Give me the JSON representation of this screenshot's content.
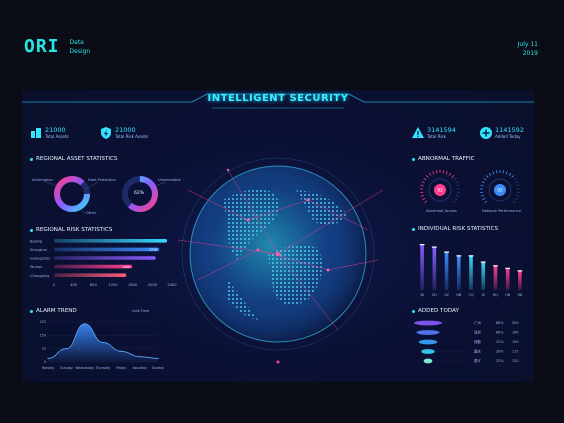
{
  "header": {
    "logo": "ORI",
    "brand_line1": "Data",
    "brand_line2": "Design",
    "date_line1": "July 11",
    "date_line2": "2019"
  },
  "title": "INTELLIGENT SECURITY",
  "stats_left": [
    {
      "value": "21000",
      "label": "Total Assets",
      "icon": "buildings-icon"
    },
    {
      "value": "21000",
      "label": "Total Risk Assets",
      "icon": "shield-bolt-icon"
    }
  ],
  "stats_right": [
    {
      "value": "3141594",
      "label": "Total Risk",
      "icon": "warning-icon"
    },
    {
      "value": "1141592",
      "label": "Added Today",
      "icon": "plus-circle-icon"
    }
  ],
  "sections": {
    "regional_asset": "REGIONAL ASSET STATISTICS",
    "regional_risk": "REGIONAL RISK STATISTICS",
    "alarm_trend": "ALARM TREND",
    "abnormal_traffic": "ABNORMAL TRAFFIC",
    "individual_risk": "INDIVIDUAL RISK STATISTICS",
    "added_today": "ADDED TODAY"
  },
  "donuts": {
    "left_labels": [
      "Information",
      "Data Protection",
      "Other"
    ],
    "right_center": "62%",
    "right_labels": [
      "Unreachable"
    ]
  },
  "regional_risk": {
    "categories": [
      "Beijing",
      "Shanghai",
      "Guangzhou",
      "Wuhan",
      "Chongqing"
    ],
    "values": [
      2300,
      2140,
      2070,
      1590,
      1470
    ],
    "value_labels": [
      "",
      "2218",
      "",
      "1988",
      ""
    ],
    "ticks": [
      "0",
      "400",
      "800",
      "1200",
      "1600",
      "2000",
      "2400"
    ],
    "xlim": [
      0,
      2400
    ],
    "colors": [
      "#38d8ff",
      "#3b8dff",
      "#8a5cff",
      "#ff3f8e",
      "#ff5a7a"
    ]
  },
  "alarm_trend": {
    "unit": "Unit:Time",
    "x": [
      "Monday",
      "Tuesday",
      "Wednesday",
      "Thursday",
      "Friday",
      "Saturday",
      "Sunday"
    ],
    "y": [
      20,
      75,
      215,
      110,
      60,
      30,
      20
    ],
    "y_ticks": [
      "0",
      "75",
      "150",
      "225"
    ],
    "ylim": [
      0,
      225
    ]
  },
  "gauges": [
    {
      "value": "92",
      "label": "Abnormal Access",
      "fraction": 0.7,
      "color": "#ff3f8e"
    },
    {
      "value": "92",
      "label": "Network Performance",
      "fraction": 0.7,
      "color": "#3b8dff"
    }
  ],
  "individual_risk": {
    "categories": [
      "BJ",
      "SH",
      "SZ",
      "HB",
      "CQ",
      "JS",
      "HLJ",
      "HN",
      "HB"
    ],
    "values": [
      36,
      34,
      30,
      27,
      27,
      22,
      19,
      17,
      15
    ],
    "colors": [
      "#8a5cff",
      "#8a5cff",
      "#3b8dff",
      "#3b8dff",
      "#38d8ff",
      "#38d8ff",
      "#ff3f8e",
      "#ff3f8e",
      "#ff3f8e"
    ],
    "ylim": [
      0,
      40
    ]
  },
  "added_today": {
    "rows": [
      {
        "name": "广州",
        "value": "88%",
        "amount": "205"
      },
      {
        "name": "深圳",
        "value": "86%",
        "amount": "160"
      },
      {
        "name": "成都",
        "value": "22%",
        "amount": "150"
      },
      {
        "name": "重庆",
        "value": "28%",
        "amount": "115"
      },
      {
        "name": "遵义",
        "value": "22%",
        "amount": "120"
      }
    ],
    "funnel_colors": [
      "#8a5cff",
      "#5a7dff",
      "#38a8ff",
      "#38d8ff",
      "#8fffe9"
    ]
  },
  "colors": {
    "accent": "#36e3ff",
    "pink": "#ff3f8e",
    "purple": "#8a5cff",
    "blue": "#3b8dff"
  }
}
